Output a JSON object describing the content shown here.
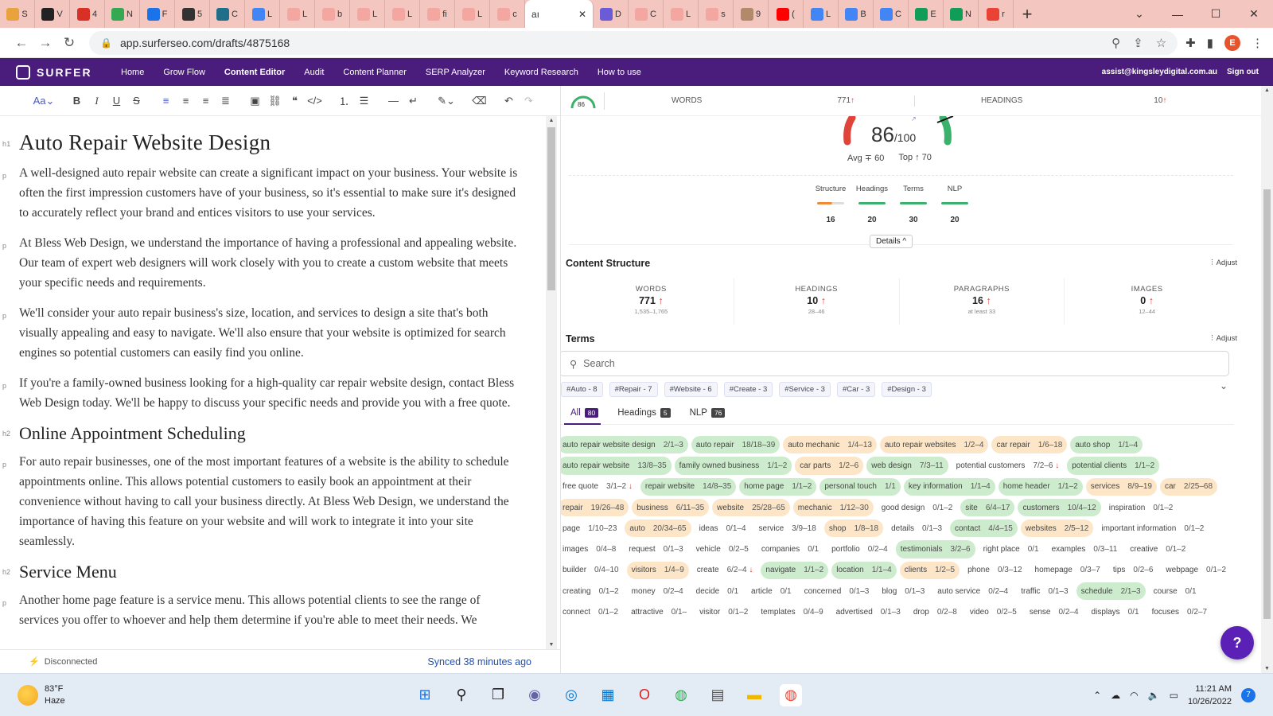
{
  "browser": {
    "tabs": [
      {
        "label": "S",
        "color": "#e8a33c"
      },
      {
        "label": "V",
        "color": "#222222"
      },
      {
        "label": "4",
        "color": "#d93025"
      },
      {
        "label": "N",
        "color": "#34a853"
      },
      {
        "label": "F",
        "color": "#1a73e8"
      },
      {
        "label": "5",
        "color": "#333333"
      },
      {
        "label": "C",
        "color": "#1f6f8b"
      },
      {
        "label": "L",
        "color": "#4285f4"
      },
      {
        "label": "L",
        "color": "#f4a6a0"
      },
      {
        "label": "b",
        "color": "#f4a6a0"
      },
      {
        "label": "L",
        "color": "#f4a6a0"
      },
      {
        "label": "L",
        "color": "#f4a6a0"
      },
      {
        "label": "fi",
        "color": "#f4a6a0"
      },
      {
        "label": "L",
        "color": "#f4a6a0"
      },
      {
        "label": "c",
        "color": "#f4a6a0"
      }
    ],
    "active_tab": "aı",
    "tabs_right": [
      {
        "label": "D",
        "color": "#6b5bd6"
      },
      {
        "label": "C",
        "color": "#f4a6a0"
      },
      {
        "label": "L",
        "color": "#f4a6a0"
      },
      {
        "label": "s",
        "color": "#f4a6a0"
      },
      {
        "label": "9",
        "color": "#b08a6a"
      },
      {
        "label": "(",
        "color": "#ff0000"
      },
      {
        "label": "L",
        "color": "#4285f4"
      },
      {
        "label": "B",
        "color": "#4285f4"
      },
      {
        "label": "C",
        "color": "#4285f4"
      },
      {
        "label": "E",
        "color": "#0f9d58"
      },
      {
        "label": "N",
        "color": "#0f9d58"
      },
      {
        "label": "r",
        "color": "#ea4335"
      }
    ],
    "url": "app.surferseo.com/drafts/4875168",
    "profile_initial": "E"
  },
  "nav": {
    "logo": "SURFER",
    "items": [
      "Home",
      "Grow Flow",
      "Content Editor",
      "Audit",
      "Content Planner",
      "SERP Analyzer",
      "Keyword Research",
      "How to use"
    ],
    "email": "assist@kingsleydigital.com.au",
    "signout": "Sign out"
  },
  "toolbar": {
    "font_label": "Aa"
  },
  "editor": {
    "tags": {
      "h1": "h1",
      "h2": "h2",
      "p": "p"
    },
    "h1": "Auto Repair Website Design",
    "p1": "A well-designed auto repair website can create a significant impact on your business. Your website is often the first impression customers have of your business, so it's essential to make sure it's designed to accurately reflect your brand and entices visitors to use your services.",
    "p2": "At Bless Web Design, we understand the importance of having a professional and appealing website. Our team of expert web designers will work closely with you to create a custom website that meets your specific needs and requirements.",
    "p3": "We'll consider your auto repair business's size, location, and services to design a site that's both visually appealing and easy to navigate. We'll also ensure that your website is optimized for search engines so potential customers can easily find you online.",
    "p4": "If you're a family-owned business looking for a high-quality car repair website design, contact Bless Web Design today. We'll be happy to discuss your specific needs and provide you with a free quote.",
    "h2a": "Online Appointment Scheduling",
    "p5": "For auto repair businesses, one of the most important features of a website is the ability to schedule appointments online. This allows potential customers to easily book an appointment at their convenience without having to call your business directly. At Bless Web Design, we understand the importance of having this feature on your website and will work to integrate it into your site seamlessly.",
    "h2b": "Service Menu",
    "p6": "Another home page feature is a service menu. This allows potential clients to see the range of services you offer to whoever and help them determine if you're able to meet their needs. We"
  },
  "status": {
    "disconnected": "Disconnected",
    "synced": "Synced 38 minutes ago"
  },
  "panel": {
    "mini_score": "86",
    "words_label": "WORDS",
    "words_value": "771",
    "headings_label": "HEADINGS",
    "headings_value": "10",
    "score": "86",
    "score_max": "/100",
    "score_level": 0.86,
    "avg": "Avg ∓ 60",
    "top": "Top ↑ 70",
    "sub": [
      {
        "label": "Structure",
        "value": "16"
      },
      {
        "label": "Headings",
        "value": "20"
      },
      {
        "label": "Terms",
        "value": "30"
      },
      {
        "label": "NLP",
        "value": "20"
      }
    ],
    "details": "Details",
    "content_structure": "Content Structure",
    "adjust": "Adjust",
    "cs": [
      {
        "label": "WORDS",
        "value": "771",
        "range": "1,535–1,765"
      },
      {
        "label": "HEADINGS",
        "value": "10",
        "range": "28–46"
      },
      {
        "label": "PARAGRAPHS",
        "value": "16",
        "range": "at least 33"
      },
      {
        "label": "IMAGES",
        "value": "0",
        "range": "12–44"
      }
    ],
    "terms_title": "Terms",
    "search_placeholder": "Search",
    "hashtags": [
      "#Auto - 8",
      "#Repair - 7",
      "#Website - 6",
      "#Create - 3",
      "#Service - 3",
      "#Car - 3",
      "#Design - 3"
    ],
    "tab_all": "All",
    "tab_all_count": "80",
    "tab_headings": "Headings",
    "tab_headings_count": "5",
    "tab_nlp": "NLP",
    "tab_nlp_count": "76"
  },
  "terms": [
    {
      "t": "auto repair website design",
      "c": "2/1–3",
      "s": "green"
    },
    {
      "t": "auto repair",
      "c": "18/18–39",
      "s": "green"
    },
    {
      "t": "auto mechanic",
      "c": "1/4–13",
      "s": "orange"
    },
    {
      "t": "auto repair websites",
      "c": "1/2–4",
      "s": "orange"
    },
    {
      "t": "car repair",
      "c": "1/6–18",
      "s": "orange"
    },
    {
      "t": "auto shop",
      "c": "1/1–4",
      "s": "green"
    },
    {
      "t": "auto repair website",
      "c": "13/8–35",
      "s": "green"
    },
    {
      "t": "family owned business",
      "c": "1/1–2",
      "s": "green"
    },
    {
      "t": "car parts",
      "c": "1/2–6",
      "s": "orange"
    },
    {
      "t": "web design",
      "c": "7/3–11",
      "s": "green"
    },
    {
      "t": "potential customers",
      "c": "7/2–6 ↓",
      "s": "plain"
    },
    {
      "t": "potential clients",
      "c": "1/1–2",
      "s": "green"
    },
    {
      "t": "free quote",
      "c": "3/1–2 ↓",
      "s": "plain"
    },
    {
      "t": "repair website",
      "c": "14/8–35",
      "s": "green"
    },
    {
      "t": "home page",
      "c": "1/1–2",
      "s": "green"
    },
    {
      "t": "personal touch",
      "c": "1/1",
      "s": "green"
    },
    {
      "t": "key information",
      "c": "1/1–4",
      "s": "green"
    },
    {
      "t": "home header",
      "c": "1/1–2",
      "s": "green"
    },
    {
      "t": "services",
      "c": "8/9–19",
      "s": "orange"
    },
    {
      "t": "car",
      "c": "2/25–68",
      "s": "orange"
    },
    {
      "t": "repair",
      "c": "19/26–48",
      "s": "orange"
    },
    {
      "t": "business",
      "c": "6/11–35",
      "s": "orange"
    },
    {
      "t": "website",
      "c": "25/28–65",
      "s": "orange"
    },
    {
      "t": "mechanic",
      "c": "1/12–30",
      "s": "orange"
    },
    {
      "t": "good design",
      "c": "0/1–2",
      "s": "plain"
    },
    {
      "t": "site",
      "c": "6/4–17",
      "s": "green"
    },
    {
      "t": "customers",
      "c": "10/4–12",
      "s": "green"
    },
    {
      "t": "inspiration",
      "c": "0/1–2",
      "s": "plain"
    },
    {
      "t": "page",
      "c": "1/10–23",
      "s": "plain"
    },
    {
      "t": "auto",
      "c": "20/34–65",
      "s": "orange"
    },
    {
      "t": "ideas",
      "c": "0/1–4",
      "s": "plain"
    },
    {
      "t": "service",
      "c": "3/9–18",
      "s": "plain"
    },
    {
      "t": "shop",
      "c": "1/8–18",
      "s": "orange"
    },
    {
      "t": "details",
      "c": "0/1–3",
      "s": "plain"
    },
    {
      "t": "contact",
      "c": "4/4–15",
      "s": "green"
    },
    {
      "t": "websites",
      "c": "2/5–12",
      "s": "orange"
    },
    {
      "t": "important information",
      "c": "0/1–2",
      "s": "plain"
    },
    {
      "t": "images",
      "c": "0/4–8",
      "s": "plain"
    },
    {
      "t": "request",
      "c": "0/1–3",
      "s": "plain"
    },
    {
      "t": "vehicle",
      "c": "0/2–5",
      "s": "plain"
    },
    {
      "t": "companies",
      "c": "0/1",
      "s": "plain"
    },
    {
      "t": "portfolio",
      "c": "0/2–4",
      "s": "plain"
    },
    {
      "t": "testimonials",
      "c": "3/2–6",
      "s": "green"
    },
    {
      "t": "right place",
      "c": "0/1",
      "s": "plain"
    },
    {
      "t": "examples",
      "c": "0/3–11",
      "s": "plain"
    },
    {
      "t": "creative",
      "c": "0/1–2",
      "s": "plain"
    },
    {
      "t": "builder",
      "c": "0/4–10",
      "s": "plain"
    },
    {
      "t": "visitors",
      "c": "1/4–9",
      "s": "orange"
    },
    {
      "t": "create",
      "c": "6/2–4 ↓",
      "s": "plain"
    },
    {
      "t": "navigate",
      "c": "1/1–2",
      "s": "green"
    },
    {
      "t": "location",
      "c": "1/1–4",
      "s": "green"
    },
    {
      "t": "clients",
      "c": "1/2–5",
      "s": "orange"
    },
    {
      "t": "phone",
      "c": "0/3–12",
      "s": "plain"
    },
    {
      "t": "homepage",
      "c": "0/3–7",
      "s": "plain"
    },
    {
      "t": "tips",
      "c": "0/2–6",
      "s": "plain"
    },
    {
      "t": "webpage",
      "c": "0/1–2",
      "s": "plain"
    },
    {
      "t": "creating",
      "c": "0/1–2",
      "s": "plain"
    },
    {
      "t": "money",
      "c": "0/2–4",
      "s": "plain"
    },
    {
      "t": "decide",
      "c": "0/1",
      "s": "plain"
    },
    {
      "t": "article",
      "c": "0/1",
      "s": "plain"
    },
    {
      "t": "concerned",
      "c": "0/1–3",
      "s": "plain"
    },
    {
      "t": "blog",
      "c": "0/1–3",
      "s": "plain"
    },
    {
      "t": "auto service",
      "c": "0/2–4",
      "s": "plain"
    },
    {
      "t": "traffic",
      "c": "0/1–3",
      "s": "plain"
    },
    {
      "t": "schedule",
      "c": "2/1–3",
      "s": "green"
    },
    {
      "t": "course",
      "c": "0/1",
      "s": "plain"
    },
    {
      "t": "connect",
      "c": "0/1–2",
      "s": "plain"
    },
    {
      "t": "attractive",
      "c": "0/1–",
      "s": "plain"
    },
    {
      "t": "visitor",
      "c": "0/1–2",
      "s": "plain"
    },
    {
      "t": "templates",
      "c": "0/4–9",
      "s": "plain"
    },
    {
      "t": "advertised",
      "c": "0/1–3",
      "s": "plain"
    },
    {
      "t": "drop",
      "c": "0/2–8",
      "s": "plain"
    },
    {
      "t": "video",
      "c": "0/2–5",
      "s": "plain"
    },
    {
      "t": "sense",
      "c": "0/2–4",
      "s": "plain"
    },
    {
      "t": "displays",
      "c": "0/1",
      "s": "plain"
    },
    {
      "t": "focuses",
      "c": "0/2–7",
      "s": "plain"
    }
  ],
  "taskbar": {
    "temp": "83°F",
    "weather": "Haze",
    "time": "11:21 AM",
    "date": "10/26/2022",
    "notif_count": "7"
  },
  "colors": {
    "brand": "#4a1c7c",
    "good": "#3ab26b",
    "warn": "#f08a35",
    "bad": "#e0433a"
  }
}
